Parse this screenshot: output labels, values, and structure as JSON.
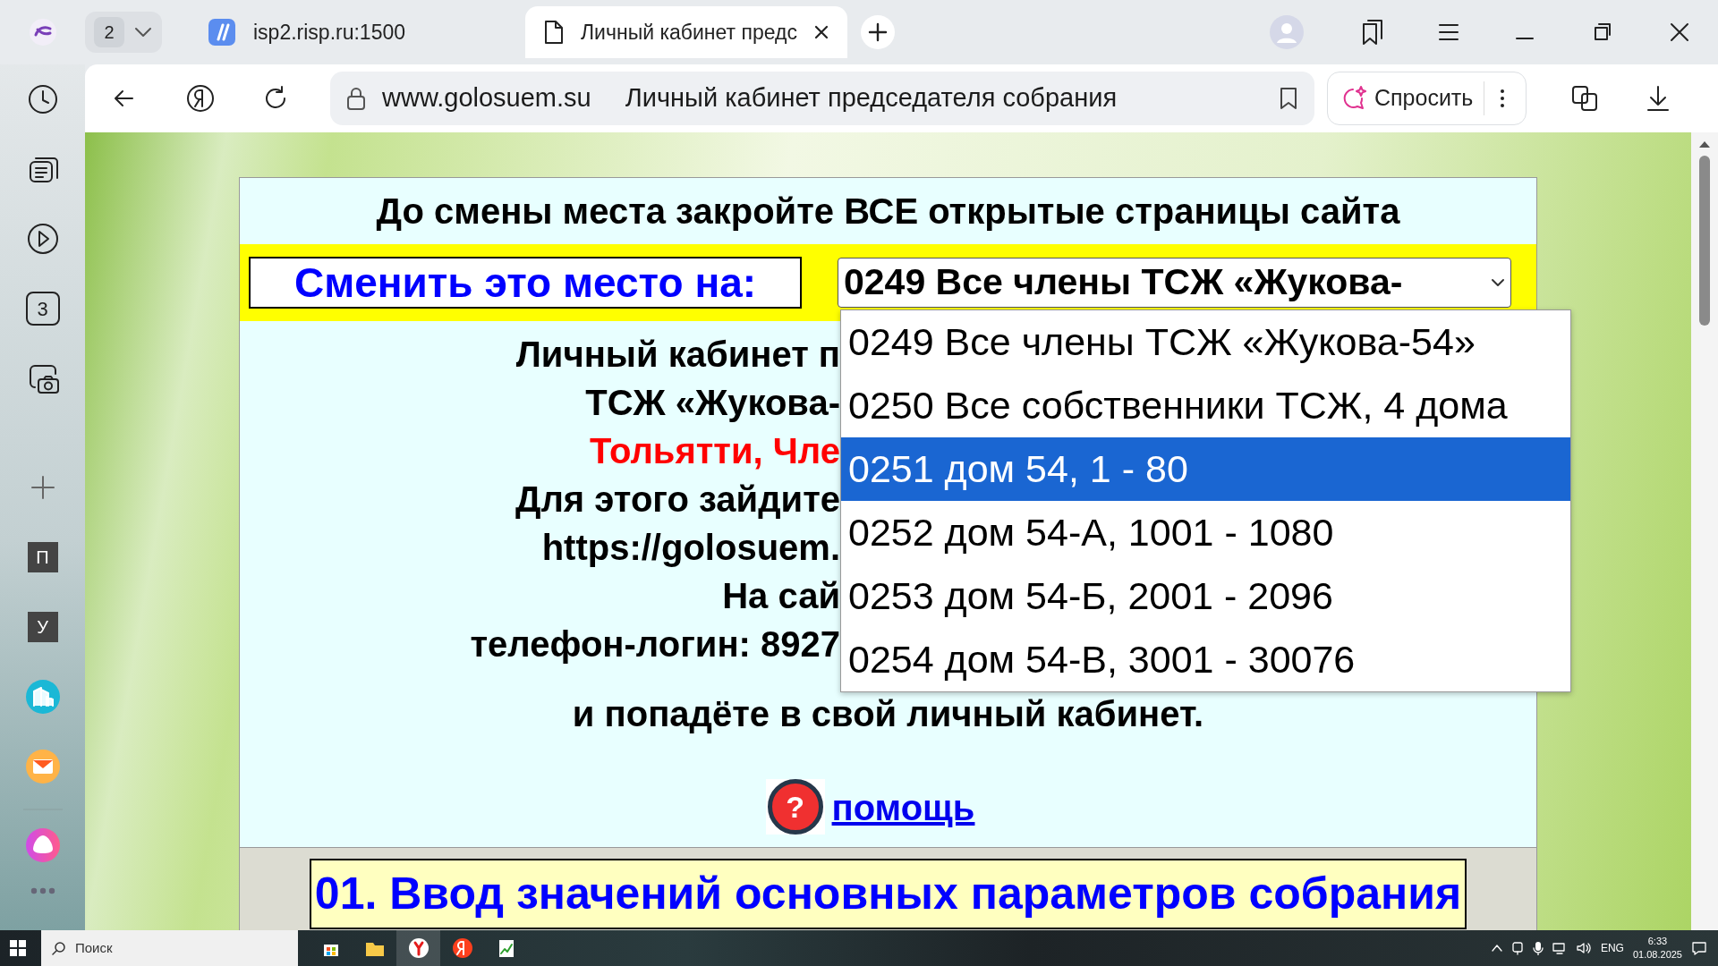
{
  "browser": {
    "tab_count": "2",
    "tabs": [
      {
        "label": "isp2.risp.ru:1500",
        "selected": false
      },
      {
        "label": "Личный кабинет предс",
        "selected": true
      }
    ],
    "address": {
      "domain": "www.golosuem.su",
      "page_title": "Личный кабинет председателя собрания"
    },
    "ask_button": "Спросить"
  },
  "sidebar": {
    "items": [
      {
        "kind": "clock"
      },
      {
        "kind": "cards"
      },
      {
        "kind": "play"
      },
      {
        "kind": "counter",
        "label": "3"
      },
      {
        "kind": "screenshot"
      },
      {
        "kind": "plus"
      },
      {
        "kind": "tile",
        "label": "П"
      },
      {
        "kind": "tile",
        "label": "У"
      },
      {
        "kind": "building"
      },
      {
        "kind": "mail"
      },
      {
        "kind": "separator"
      },
      {
        "kind": "alice"
      },
      {
        "kind": "more"
      }
    ]
  },
  "page": {
    "warning": "До смены места закройте ВСЕ открытые страницы сайта",
    "change_label": "Сменить это место на:",
    "select": {
      "value": "0249 Все члены ТСЖ «Жукова-",
      "options": [
        {
          "label": "0249 Все члены ТСЖ «Жукова-54»",
          "selected": false
        },
        {
          "label": "0250 Все собственники ТСЖ, 4 дома",
          "selected": false
        },
        {
          "label": "0251 дом 54, 1 - 80",
          "selected": true
        },
        {
          "label": "0252 дом 54-А, 1001 - 1080",
          "selected": false
        },
        {
          "label": "0253 дом 54-Б, 2001 - 2096",
          "selected": false
        },
        {
          "label": "0254 дом 54-В, 3001 - 30076",
          "selected": false
        }
      ]
    },
    "info_lines": [
      {
        "kind": "normal",
        "text": "Личный кабинет п"
      },
      {
        "kind": "normal",
        "text": "ТСЖ «Жукова-"
      },
      {
        "kind": "alert",
        "text": "Тольятти, Чле"
      },
      {
        "kind": "normal",
        "text": "Для этого зайдите"
      },
      {
        "kind": "normal",
        "text": "https://golosuem."
      },
      {
        "kind": "normal",
        "text": "На сай"
      },
      {
        "kind": "normal",
        "text": "телефон-логин: 8927"
      },
      {
        "kind": "normal",
        "text": "и попадёте в свой личный кабинет."
      }
    ],
    "help": {
      "icon_glyph": "?",
      "link": "помощь"
    },
    "section_title": "01. Ввод значений основных параметров собрания"
  },
  "taskbar": {
    "search_placeholder": "Поиск",
    "language": "ENG",
    "time": "6:33",
    "date": "01.08.2025"
  }
}
